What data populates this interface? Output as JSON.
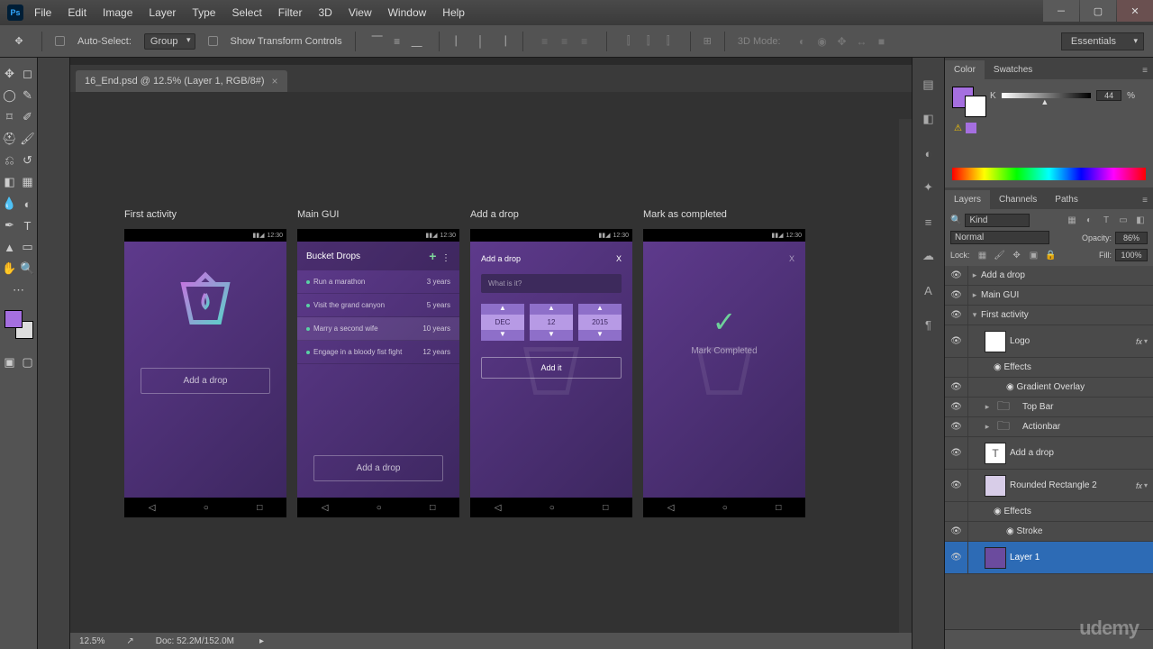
{
  "app": {
    "logo_text": "Ps"
  },
  "menus": [
    "File",
    "Edit",
    "Image",
    "Layer",
    "Type",
    "Select",
    "Filter",
    "3D",
    "View",
    "Window",
    "Help"
  ],
  "options": {
    "auto_select": "Auto-Select:",
    "group": "Group",
    "show_transform": "Show Transform Controls",
    "mode3d": "3D Mode:",
    "workspace": "Essentials"
  },
  "tab": {
    "title": "16_End.psd @ 12.5% (Layer 1, RGB/8#)"
  },
  "mockups": {
    "m1": {
      "label": "First activity",
      "time": "12:30",
      "button": "Add a drop"
    },
    "m2": {
      "label": "Main GUI",
      "time": "12:30",
      "header": "Bucket Drops",
      "button": "Add a drop",
      "items": [
        {
          "text": "Run a marathon",
          "due": "3 years"
        },
        {
          "text": "Visit the grand canyon",
          "due": "5 years"
        },
        {
          "text": "Marry a second wife",
          "due": "10 years"
        },
        {
          "text": "Engage in a bloody fist fight",
          "due": "12 years"
        }
      ]
    },
    "m3": {
      "label": "Add a drop",
      "time": "12:30",
      "modal_title": "Add a drop",
      "close": "X",
      "placeholder": "What is it?",
      "date": {
        "month": "DEC",
        "day": "12",
        "year": "2015"
      },
      "add_button": "Add it"
    },
    "m4": {
      "label": "Mark as completed",
      "time": "12:30",
      "text": "Mark Completed"
    }
  },
  "status": {
    "zoom": "12.5%",
    "doc": "Doc: 52.2M/152.0M"
  },
  "color_panel": {
    "tab_color": "Color",
    "tab_swatches": "Swatches",
    "k_label": "K",
    "k_value": "44",
    "k_unit": "%"
  },
  "layers_panel": {
    "tab_layers": "Layers",
    "tab_channels": "Channels",
    "tab_paths": "Paths",
    "filter_label": "Kind",
    "blend": "Normal",
    "opacity_label": "Opacity:",
    "opacity_val": "86%",
    "lock_label": "Lock:",
    "fill_label": "Fill:",
    "fill_val": "100%",
    "rows": {
      "add_drop": "Add a drop",
      "main_gui": "Main GUI",
      "first_activity": "First activity",
      "logo": "Logo",
      "effects1": "Effects",
      "gradient": "Gradient Overlay",
      "topbar": "Top Bar",
      "actionbar": "Actionbar",
      "add_drop_txt": "Add a drop",
      "rrect": "Rounded Rectangle 2",
      "effects2": "Effects",
      "stroke": "Stroke",
      "layer1": "Layer 1"
    }
  },
  "watermark": "udemy"
}
